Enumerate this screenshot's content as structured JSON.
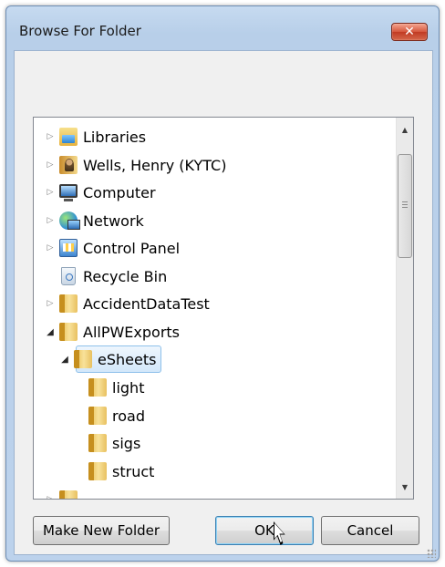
{
  "dialog": {
    "title": "Browse For Folder",
    "close_glyph": "✕"
  },
  "tree": {
    "items": [
      {
        "label": "Libraries",
        "icon": "libraries-icon",
        "expander": "collapsed"
      },
      {
        "label": "Wells, Henry (KYTC)",
        "icon": "user-folder-icon",
        "expander": "collapsed"
      },
      {
        "label": "Computer",
        "icon": "computer-icon",
        "expander": "collapsed"
      },
      {
        "label": "Network",
        "icon": "network-icon",
        "expander": "collapsed"
      },
      {
        "label": "Control Panel",
        "icon": "control-panel-icon",
        "expander": "collapsed"
      },
      {
        "label": "Recycle Bin",
        "icon": "recycle-bin-icon",
        "expander": "none"
      },
      {
        "label": "AccidentDataTest",
        "icon": "folder-icon",
        "expander": "collapsed"
      },
      {
        "label": "AllPWExports",
        "icon": "folder-icon",
        "expander": "expanded"
      },
      {
        "label": "eSheets",
        "icon": "folder-icon",
        "expander": "expanded",
        "selected": true
      },
      {
        "label": "light",
        "icon": "folder-icon",
        "expander": "none"
      },
      {
        "label": "road",
        "icon": "folder-icon",
        "expander": "none"
      },
      {
        "label": "sigs",
        "icon": "folder-icon",
        "expander": "none"
      },
      {
        "label": "struct",
        "icon": "folder-icon",
        "expander": "none"
      }
    ]
  },
  "buttons": {
    "make_new_folder": "Make New Folder",
    "ok": "OK",
    "cancel": "Cancel"
  },
  "glyphs": {
    "collapsed": "▷",
    "expanded": "◢",
    "scroll_up": "▲",
    "scroll_down": "▼"
  },
  "colors": {
    "title_bar": "#c6daf0",
    "close_button": "#c13a23",
    "selection": "#d3e7fa",
    "default_button_border": "#3c7fb1"
  }
}
